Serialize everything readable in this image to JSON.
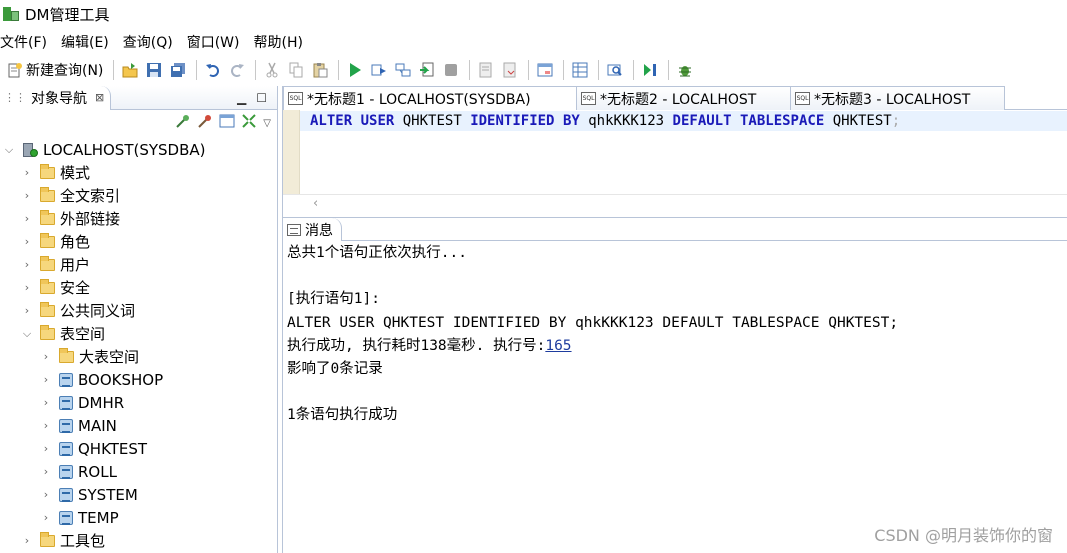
{
  "window": {
    "title": "DM管理工具"
  },
  "menu": [
    "文件(F)",
    "编辑(E)",
    "查询(Q)",
    "窗口(W)",
    "帮助(H)"
  ],
  "toolbar": {
    "new_query_label": "新建查询(N)"
  },
  "navigator": {
    "tab_label": "对象导航",
    "root": "LOCALHOST(SYSDBA)",
    "items": [
      "模式",
      "全文索引",
      "外部链接",
      "角色",
      "用户",
      "安全",
      "公共同义词",
      "表空间"
    ],
    "tablespaces": [
      "大表空间",
      "BOOKSHOP",
      "DMHR",
      "MAIN",
      "QHKTEST",
      "ROLL",
      "SYSTEM",
      "TEMP"
    ],
    "tools": "工具包"
  },
  "editor": {
    "tabs": [
      "*无标题1 - LOCALHOST(SYSDBA)",
      "*无标题2 - LOCALHOST",
      "*无标题3 - LOCALHOST"
    ],
    "sql": {
      "t1": "ALTER",
      "t2": "USER",
      "t3": "QHKTEST",
      "t4": "IDENTIFIED",
      "t5": "BY",
      "t6": "qhkKKK123",
      "t7": "DEFAULT",
      "t8": "TABLESPACE",
      "t9": "QHKTEST",
      "t10": ";"
    }
  },
  "messages": {
    "tab_label": "消息",
    "line1": "总共1个语句正依次执行...",
    "line2": "[执行语句1]:",
    "line3": "ALTER USER QHKTEST IDENTIFIED BY qhkKKK123 DEFAULT TABLESPACE QHKTEST;",
    "line4_prefix": "执行成功, 执行耗时138毫秒. 执行号:",
    "line4_link": "165",
    "line5": "影响了0条记录",
    "line6": "1条语句执行成功"
  },
  "watermark": "CSDN @明月装饰你的窗"
}
